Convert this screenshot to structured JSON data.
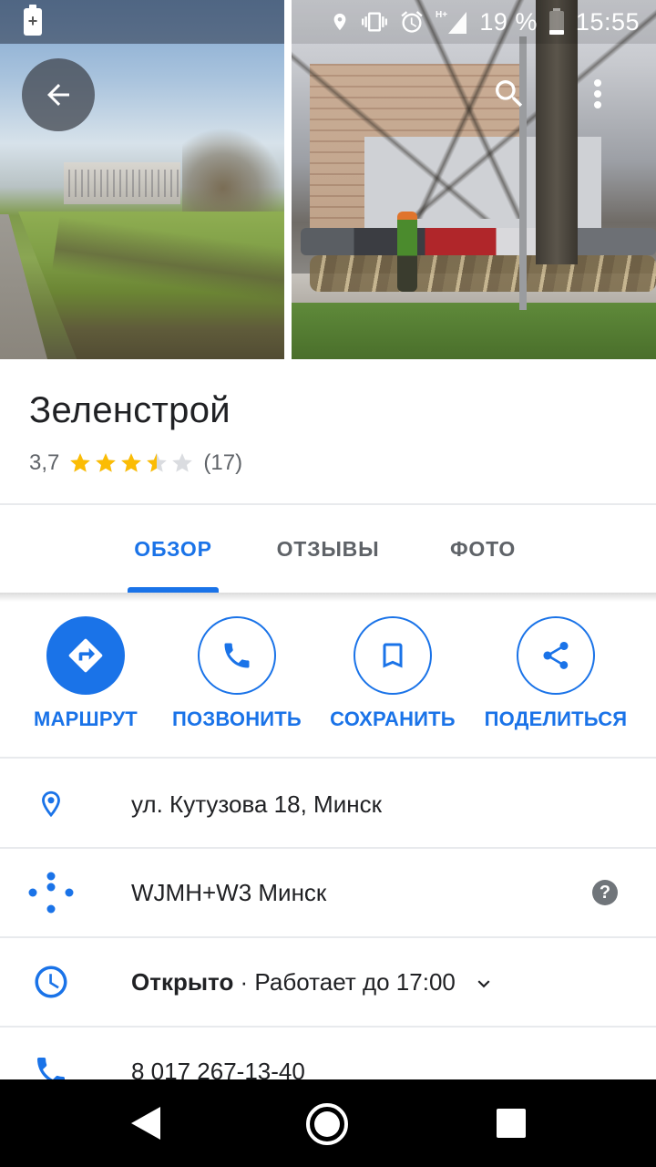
{
  "status_bar": {
    "battery_percent": "19 %",
    "time": "15:55",
    "network": "H+"
  },
  "place": {
    "title": "Зеленстрой",
    "rating": "3,7",
    "rating_value": 3.7,
    "review_count": "(17)"
  },
  "tabs": [
    {
      "label": "ОБЗОР",
      "active": true
    },
    {
      "label": "ОТЗЫВЫ",
      "active": false
    },
    {
      "label": "ФОТО",
      "active": false
    }
  ],
  "actions": [
    {
      "label": "МАРШРУТ",
      "icon": "directions-icon"
    },
    {
      "label": "ПОЗВОНИТЬ",
      "icon": "phone-icon"
    },
    {
      "label": "СОХРАНИТЬ",
      "icon": "bookmark-icon"
    },
    {
      "label": "ПОДЕЛИТЬСЯ",
      "icon": "share-icon"
    }
  ],
  "info": {
    "address": "ул. Кутузова 18, Минск",
    "plus_code": "WJMH+W3 Минск",
    "hours_status": "Открыто",
    "hours_detail": " · Работает до 17:00",
    "phone": "8 017 267-13-40"
  },
  "colors": {
    "accent": "#1a73e8",
    "star": "#fbbc04",
    "star_empty": "#dadce0",
    "text_secondary": "#5f6368"
  }
}
